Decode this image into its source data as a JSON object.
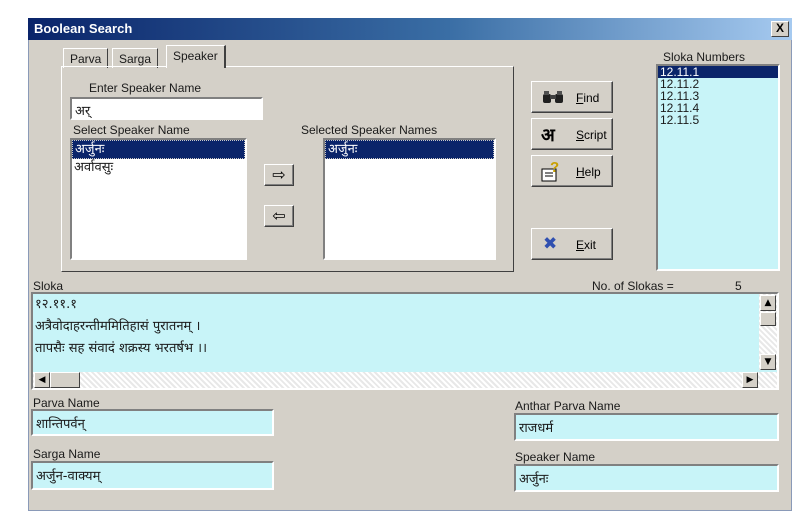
{
  "window": {
    "title": "Boolean Search",
    "close_label": "X"
  },
  "tabs": [
    {
      "label": "Parva"
    },
    {
      "label": "Sarga"
    },
    {
      "label": "Speaker"
    }
  ],
  "speaker_panel": {
    "enter_label": "Enter Speaker Name",
    "enter_value": "अर्",
    "select_label": "Select Speaker Name",
    "select_items": [
      {
        "text": "अर्जुनः"
      },
      {
        "text": "अर्वावसुः"
      }
    ],
    "selected_label": "Selected Speaker Names",
    "selected_items": [
      {
        "text": "अर्जुनः"
      }
    ],
    "add_arrow": "⇨",
    "remove_arrow": "⇦"
  },
  "buttons": {
    "find": {
      "pre": "",
      "ul": "F",
      "post": "ind",
      "icon": "binoculars-icon"
    },
    "script": {
      "pre": "",
      "ul": "S",
      "post": "cript",
      "icon_text": "अ",
      "icon": "devanagari-a-icon"
    },
    "help": {
      "pre": "",
      "ul": "H",
      "post": "elp",
      "icon_text": "?",
      "icon": "help-book-icon"
    },
    "exit": {
      "pre": "",
      "ul": "E",
      "post": "xit",
      "icon_text": "✖",
      "icon": "exit-x-icon"
    }
  },
  "sloka_numbers": {
    "label": "Sloka Numbers",
    "items": [
      {
        "text": "12.11.1"
      },
      {
        "text": "12.11.2"
      },
      {
        "text": "12.11.3"
      },
      {
        "text": "12.11.4"
      },
      {
        "text": "12.11.5"
      }
    ]
  },
  "sloka": {
    "label": "Sloka",
    "count_label": "No. of Slokas =",
    "count_value": "5",
    "lines": [
      {
        "text": "१२.११.१"
      },
      {
        "text": "अत्रैवोदाहरन्तीममितिहासं पुरातनम् ।"
      },
      {
        "text": "तापसैः सह संवादं शक्रस्य भरतर्षभ ।।"
      }
    ]
  },
  "fields": {
    "parva_name": {
      "label": "Parva Name",
      "value": "शान्तिपर्वन्"
    },
    "anthar_parva_name": {
      "label": "Anthar Parva Name",
      "value": "राजधर्म"
    },
    "sarga_name": {
      "label": "Sarga Name",
      "value": "अर्जुन-वाक्यम्"
    },
    "speaker_name": {
      "label": "Speaker Name",
      "value": "अर्जुनः"
    }
  },
  "colors": {
    "title_gradient_start": "#0a246a",
    "window_face": "#d4d0c8",
    "field_background": "#c8f4f8",
    "selection": "#0a246a"
  }
}
